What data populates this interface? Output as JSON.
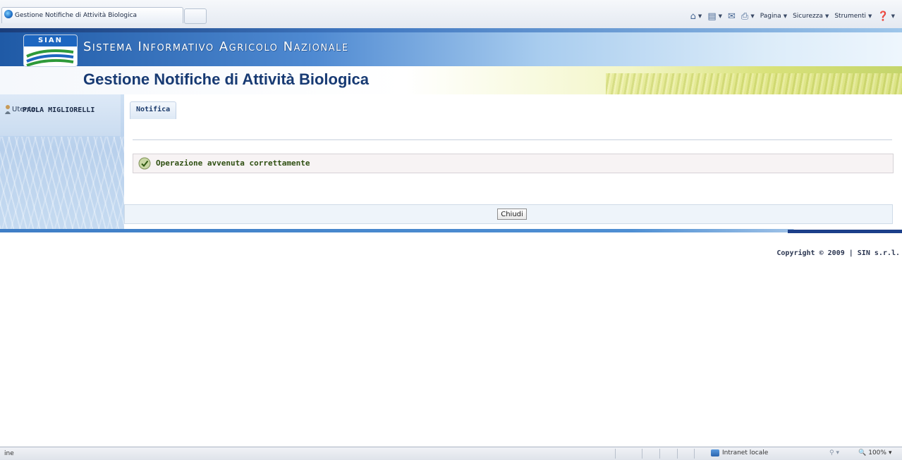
{
  "browser": {
    "tab_title": "Gestione Notifiche di Attività Biologica",
    "toolbar": {
      "page_label": "Pagina",
      "security_label": "Sicurezza",
      "tools_label": "Strumenti"
    }
  },
  "header": {
    "logo_text": "SIAN",
    "system_title": "Sistema Informativo Agricolo Nazionale",
    "app_title": "Gestione Notifiche di Attività Biologica"
  },
  "sidebar": {
    "user_label": "Utente:",
    "user_name": "PAOLA MIGLIORELLI"
  },
  "main": {
    "tab_label": "Notifica",
    "message": "Operazione avvenuta correttamente",
    "close_button": "Chiudi"
  },
  "footer": {
    "copyright": "Copyright © 2009 | SIN s.r.l."
  },
  "status_bar": {
    "left_text": "ine",
    "zone": "Intranet locale",
    "zoom": "100%"
  }
}
